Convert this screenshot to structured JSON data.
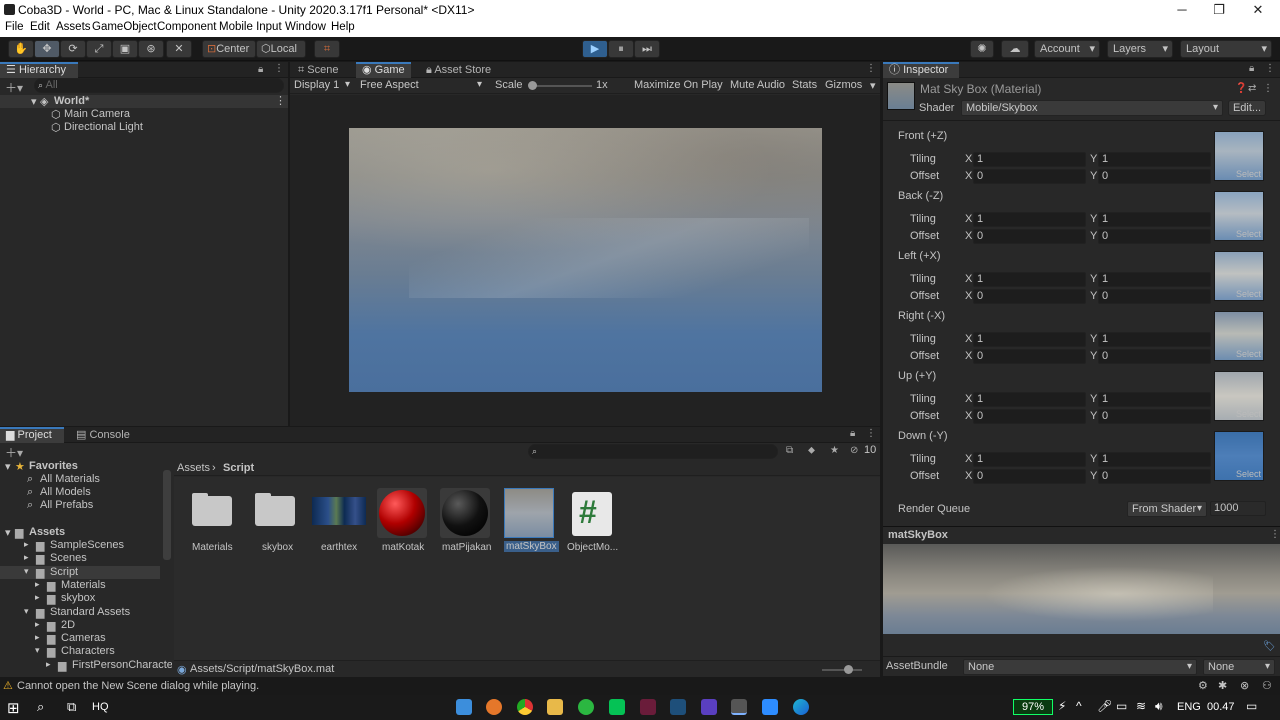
{
  "window": {
    "title": "Coba3D - World - PC, Mac & Linux Standalone - Unity 2020.3.17f1 Personal* <DX11>",
    "minimize": "─",
    "maximize": "❐",
    "close": "✕"
  },
  "menu": [
    "File",
    "Edit",
    "Assets",
    "GameObject",
    "Component",
    "Mobile Input",
    "Window",
    "Help"
  ],
  "toolbar": {
    "pivot": "Center",
    "space": "Local",
    "play": "▶",
    "pause": "⏸",
    "step": "⏭",
    "account": "Account",
    "layers": "Layers",
    "layout": "Layout"
  },
  "hierarchy": {
    "tab": "Hierarchy",
    "search_placeholder": "All",
    "scene": "World*",
    "items": [
      "Main Camera",
      "Directional Light"
    ]
  },
  "gameview": {
    "tabs": [
      "Scene",
      "Game",
      "Asset Store"
    ],
    "display": "Display 1",
    "aspect": "Free Aspect",
    "scale_label": "Scale",
    "scale_value": "1x",
    "toggles": [
      "Maximize On Play",
      "Mute Audio",
      "Stats",
      "Gizmos"
    ]
  },
  "project": {
    "tabs": [
      "Project",
      "Console"
    ],
    "favorites_label": "Favorites",
    "favorites": [
      "All Materials",
      "All Models",
      "All Prefabs"
    ],
    "assets_label": "Assets",
    "tree": [
      {
        "label": "SampleScenes",
        "indent": 1
      },
      {
        "label": "Scenes",
        "indent": 1
      },
      {
        "label": "Script",
        "indent": 1
      },
      {
        "label": "Materials",
        "indent": 2
      },
      {
        "label": "skybox",
        "indent": 2
      },
      {
        "label": "Standard Assets",
        "indent": 1
      },
      {
        "label": "2D",
        "indent": 2
      },
      {
        "label": "Cameras",
        "indent": 2
      },
      {
        "label": "Characters",
        "indent": 2
      },
      {
        "label": "FirstPersonCharacte",
        "indent": 3
      }
    ],
    "breadcrumb": [
      "Assets",
      "Script"
    ],
    "visible_count": "10",
    "assets": [
      "Materials",
      "skybox",
      "earthtex",
      "matKotak",
      "matPijakan",
      "matSkyBox",
      "ObjectMo..."
    ],
    "selected_path": "Assets/Script/matSkyBox.mat"
  },
  "inspector": {
    "tab": "Inspector",
    "material_name": "Mat Sky Box (Material)",
    "shader_label": "Shader",
    "shader_value": "Mobile/Skybox",
    "edit_label": "Edit...",
    "faces": [
      "Front (+Z)",
      "Back (-Z)",
      "Left (+X)",
      "Right (-X)",
      "Up (+Y)",
      "Down (-Y)"
    ],
    "tiling_label": "Tiling",
    "offset_label": "Offset",
    "x_label": "X",
    "y_label": "Y",
    "tiling_x": "1",
    "tiling_y": "1",
    "offset_x": "0",
    "offset_y": "0",
    "select_label": "Select",
    "render_queue_label": "Render Queue",
    "render_queue_mode": "From Shader",
    "render_queue_value": "1000",
    "preview_title": "matSkyBox",
    "assetbundle_label": "AssetBundle",
    "assetbundle_value": "None",
    "assetbundle_variant": "None"
  },
  "status": {
    "message": "Cannot open the New Scene dialog while playing."
  },
  "taskbar": {
    "search": "HQ",
    "battery": "97%",
    "lang": "ENG",
    "time": "00.47"
  },
  "colors": {
    "accent": "#3a79bb",
    "panel": "#282828",
    "play_active": "#2f5f8f"
  }
}
